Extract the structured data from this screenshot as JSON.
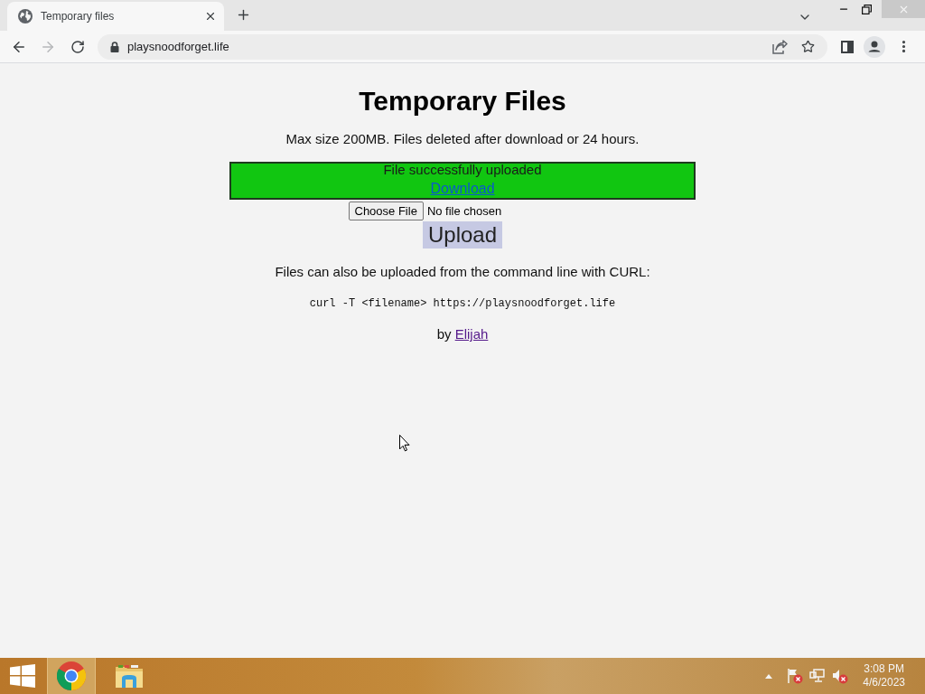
{
  "browser": {
    "tab": {
      "title": "Temporary files",
      "selected": true
    },
    "address": "playsnoodforget.life"
  },
  "page": {
    "title": "Temporary Files",
    "subtitle": "Max size 200MB. Files deleted after download or 24 hours.",
    "notice": {
      "message": "File successfully uploaded",
      "link": {
        "text": "Download",
        "visited": false
      }
    },
    "file_input": {
      "button": "Choose File",
      "status": "No file chosen"
    },
    "upload_button": "Upload",
    "curl_note": "Files can also be uploaded from the command line with CURL:",
    "curl_command": "curl -T <filename> https://playsnoodforget.life",
    "credit": {
      "prefix": "by",
      "link": {
        "text": "Elijah",
        "visited": true
      }
    }
  },
  "taskbar": {
    "apps": [
      {
        "kind": "chrome",
        "selected": true
      },
      {
        "kind": "explorer",
        "selected": false
      }
    ],
    "clock": {
      "time": "3:08 PM",
      "date": "4/6/2023"
    }
  }
}
